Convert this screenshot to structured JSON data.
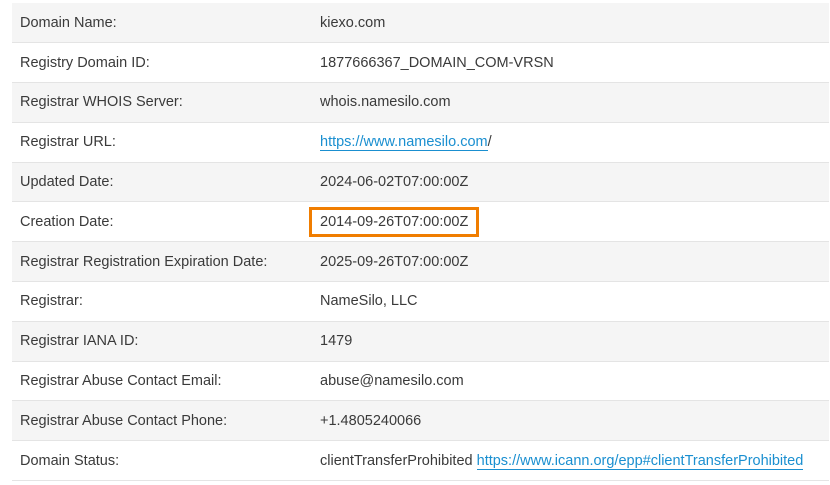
{
  "rows": [
    {
      "label": "Domain Name:",
      "value": "kiexo.com"
    },
    {
      "label": "Registry Domain ID:",
      "value": "1877666367_DOMAIN_COM-VRSN"
    },
    {
      "label": "Registrar WHOIS Server:",
      "value": "whois.namesilo.com"
    },
    {
      "label": "Registrar URL:",
      "link": "https://www.namesilo.com",
      "suffix": "/"
    },
    {
      "label": "Updated Date:",
      "value": "2024-06-02T07:00:00Z"
    },
    {
      "label": "Creation Date:",
      "value": "2014-09-26T07:00:00Z"
    },
    {
      "label": "Registrar Registration Expiration Date:",
      "value": "2025-09-26T07:00:00Z"
    },
    {
      "label": "Registrar:",
      "value": "NameSilo, LLC"
    },
    {
      "label": "Registrar IANA ID:",
      "value": "1479"
    },
    {
      "label": "Registrar Abuse Contact Email:",
      "value": "abuse@namesilo.com"
    },
    {
      "label": "Registrar Abuse Contact Phone:",
      "value": "+1.4805240066"
    },
    {
      "label": "Domain Status:",
      "value": "clientTransferProhibited",
      "link": "https://www.icann.org/epp#clientTransferProhibited"
    }
  ],
  "highlight_color": "#f07d00",
  "link_color": "#1a8fd0"
}
